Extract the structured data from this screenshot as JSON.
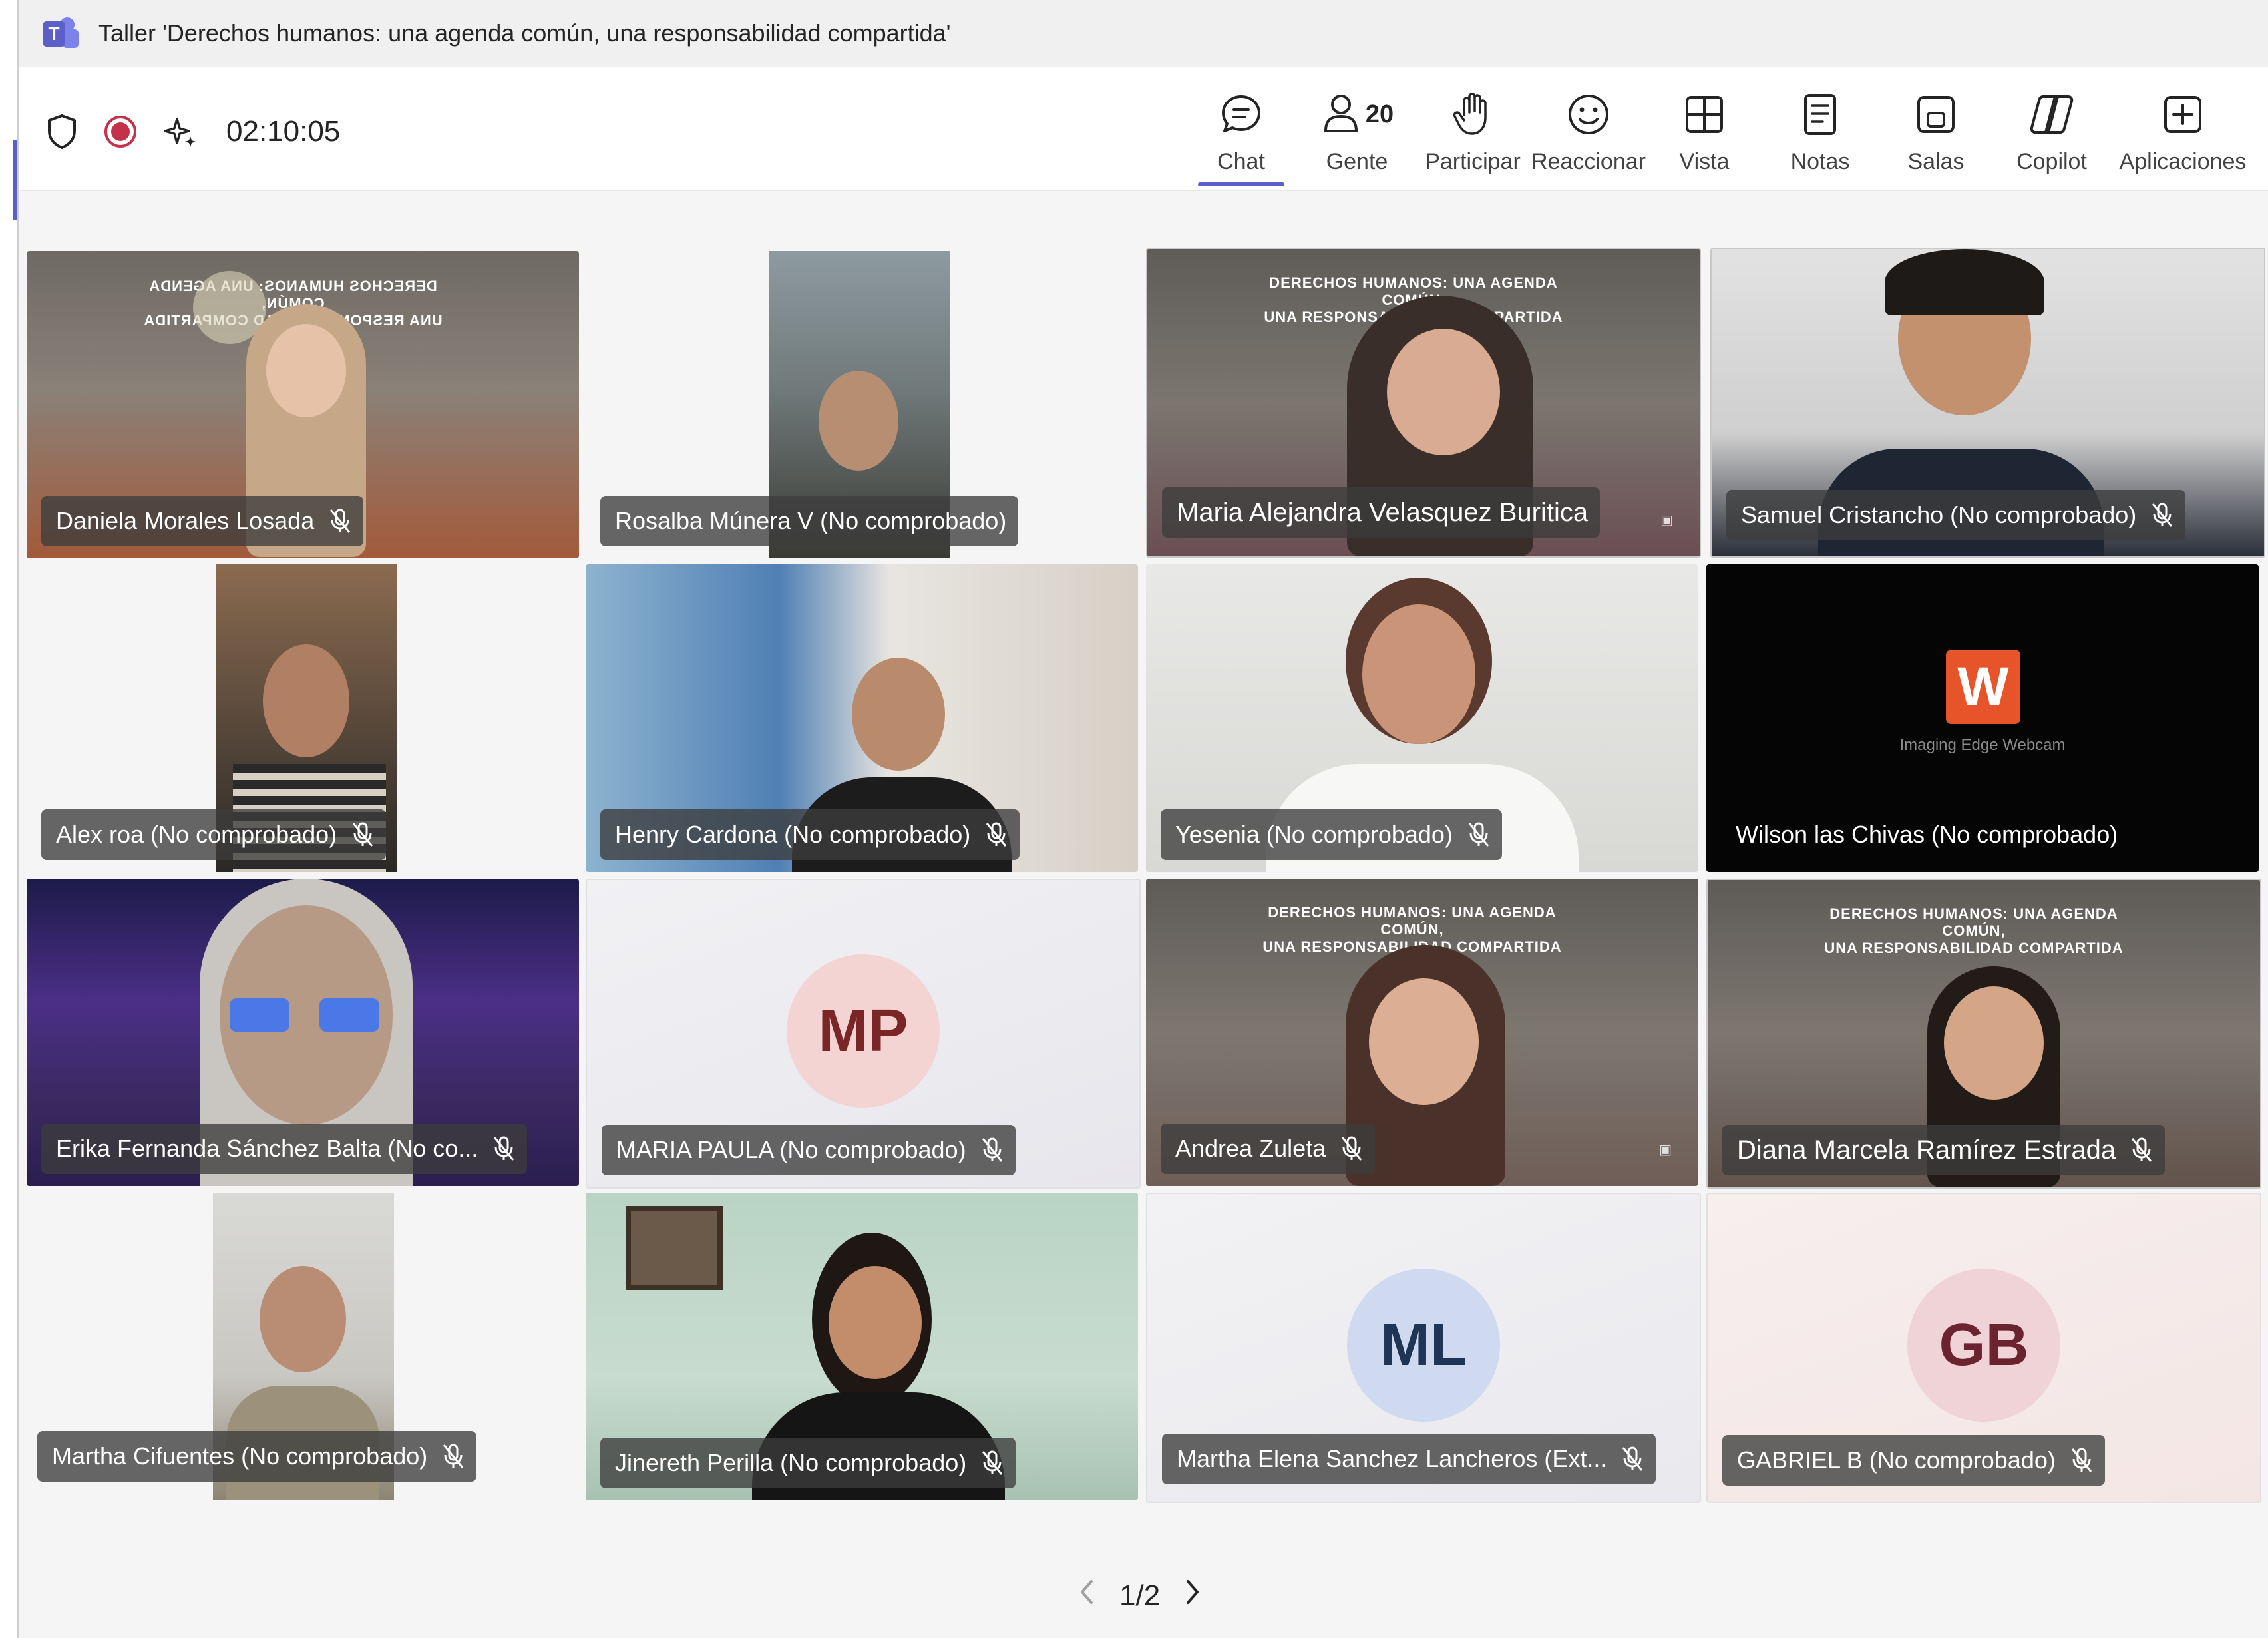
{
  "window": {
    "title": "Taller 'Derechos humanos: una agenda común, una responsabilidad compartida'"
  },
  "toolbar": {
    "timer": "02:10:05",
    "buttons": {
      "chat": "Chat",
      "people": "Gente",
      "people_count": "20",
      "raise": "Participar",
      "react": "Reaccionar",
      "view": "Vista",
      "notes": "Notas",
      "rooms": "Salas",
      "copilot": "Copilot",
      "apps": "Aplicaciones"
    },
    "accent_color": "#5b5fc7",
    "record_color": "#c4314b"
  },
  "banner": {
    "line1": "DERECHOS HUMANOS: UNA AGENDA COMÚN,",
    "line2": "UNA RESPONSABILIDAD COMPARTIDA"
  },
  "participants": [
    {
      "name": "Daniela Morales Losada"
    },
    {
      "name": "Rosalba Múnera V (No comprobado)"
    },
    {
      "name": "Maria Alejandra Velasquez Buritica"
    },
    {
      "name": "Samuel Cristancho (No comprobado)"
    },
    {
      "name": "Alex roa (No comprobado)"
    },
    {
      "name": "Henry Cardona (No comprobado)"
    },
    {
      "name": "Yesenia (No comprobado)"
    },
    {
      "name": "Wilson las Chivas (No comprobado)",
      "app_text": "Imaging Edge Webcam",
      "app_logo": "W"
    },
    {
      "name": "Erika Fernanda Sánchez Balta (No co..."
    },
    {
      "name": "MARIA PAULA (No comprobado)",
      "initials": "MP"
    },
    {
      "name": "Andrea Zuleta"
    },
    {
      "name": "Diana Marcela Ramírez Estrada"
    },
    {
      "name": "Martha Cifuentes (No comprobado)"
    },
    {
      "name": "Jinereth Perilla (No comprobado)"
    },
    {
      "name": "Martha Elena Sanchez Lancheros (Ext...",
      "initials": "ML"
    },
    {
      "name": "GABRIEL B (No comprobado)",
      "initials": "GB"
    }
  ],
  "pager": {
    "text": "1/2"
  }
}
